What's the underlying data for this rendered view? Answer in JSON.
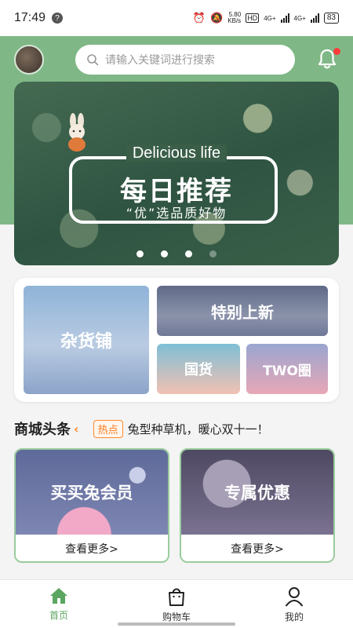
{
  "status_bar": {
    "time": "17:49",
    "net_speed_value": "5.80",
    "net_speed_unit": "KB/s",
    "hd_label": "HD",
    "sim1_label": "4G+",
    "sim2_label": "4G+",
    "battery": "83"
  },
  "header": {
    "search_placeholder": "请输入关键词进行搜索"
  },
  "banner": {
    "english_title": "Delicious life",
    "title": "每日推荐",
    "subtitle": "“优”选品质好物",
    "slides": 4,
    "active_slide": 1
  },
  "categories": [
    {
      "label": "杂货铺"
    },
    {
      "label": "特别上新"
    },
    {
      "label": "国货"
    },
    {
      "label": "TWO圈"
    }
  ],
  "news": {
    "title": "商城头条",
    "tag": "热点",
    "headline": "兔型种草机，暖心双十一！"
  },
  "promos": [
    {
      "title": "买买兔会员",
      "more": "查看更多>"
    },
    {
      "title": "专属优惠",
      "more": "查看更多>"
    }
  ],
  "nav": [
    {
      "label": "首页",
      "icon": "home-icon",
      "active": true
    },
    {
      "label": "购物车",
      "icon": "shopping-bag-icon",
      "active": false
    },
    {
      "label": "我的",
      "icon": "user-icon",
      "active": false
    }
  ],
  "colors": {
    "brand_green": "#7fb886",
    "active_green": "#5aa55f",
    "hot_orange": "#ff8a2a",
    "badge_red": "#ff3b3b"
  }
}
